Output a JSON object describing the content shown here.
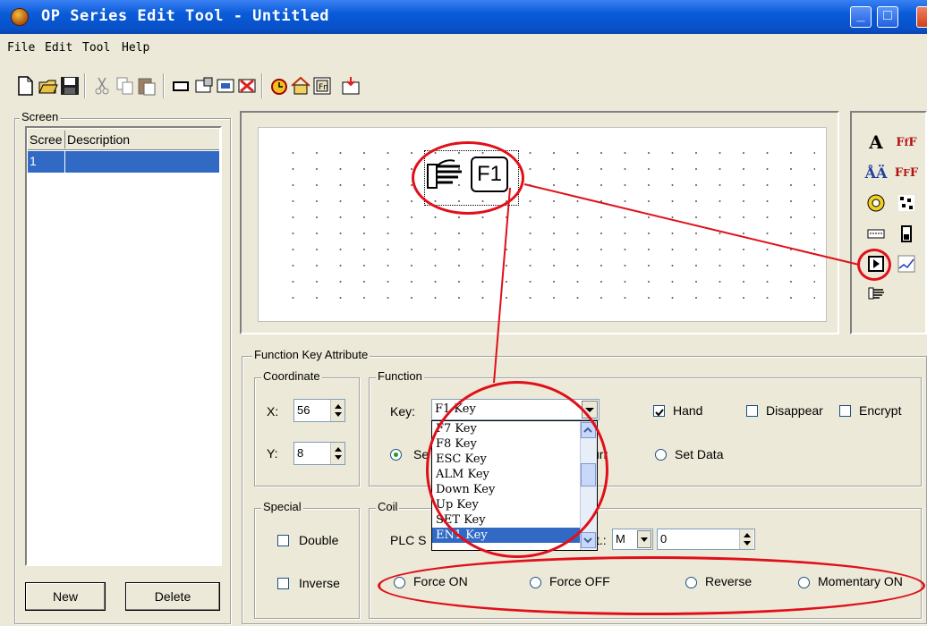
{
  "window": {
    "title": "OP Series Edit Tool - Untitled"
  },
  "menu": [
    "File",
    "Edit",
    "Tool",
    "Help"
  ],
  "screen_panel": {
    "label": "Screen",
    "columns": [
      "Scree",
      "Description"
    ],
    "rows": [
      {
        "no": "1",
        "description": ""
      }
    ],
    "new_label": "New",
    "delete_label": "Delete"
  },
  "canvas": {
    "key_text": "F1"
  },
  "fk_attr": {
    "title": "Function Key Attribute",
    "coordinate": {
      "label": "Coordinate",
      "x_label": "X:",
      "x_value": "56",
      "y_label": "Y:",
      "y_value": "8"
    },
    "function": {
      "label": "Function",
      "key_label": "Key:",
      "key_value": "F1 Key",
      "hand_label": "Hand",
      "disappear_label": "Disappear",
      "encrypt_label": "Encrypt",
      "radio1": "Se",
      "radio2": "urr",
      "set_data_label": "Set Data"
    },
    "special": {
      "label": "Special",
      "double_label": "Double",
      "inverse_label": "Inverse"
    },
    "coil": {
      "label": "Coil",
      "plc_label": "PLC S",
      "mid_label": "t.:",
      "device_value": "M",
      "address_value": "0",
      "force_on": "Force ON",
      "force_off": "Force OFF",
      "reverse": "Reverse",
      "momentary_on": "Momentary ON"
    }
  },
  "dropdown_options": [
    "F7 Key",
    "F8 Key",
    "ESC Key",
    "ALM Key",
    "Down Key",
    "Up Key",
    "SET Key",
    "EN1 Key"
  ],
  "selected_option": "EN1 Key",
  "colors": {
    "titlebar": "#0a5bd8",
    "selection": "#316ac5",
    "annotation": "#e0101a"
  }
}
